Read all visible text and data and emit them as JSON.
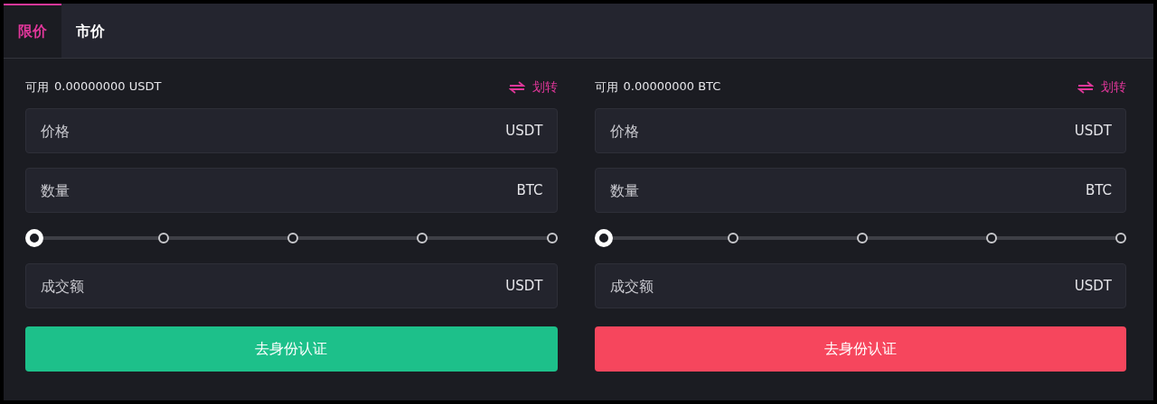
{
  "tabs": [
    {
      "label": "限价",
      "selected": true
    },
    {
      "label": "市价",
      "selected": false
    }
  ],
  "panels": [
    {
      "available_label": "可用",
      "available_value": "0.00000000 USDT",
      "transfer": "划转",
      "fields": [
        {
          "placeholder": "价格",
          "unit": "USDT"
        },
        {
          "placeholder": "数量",
          "unit": "BTC"
        }
      ],
      "slider": {
        "level": 0
      },
      "total": {
        "placeholder": "成交额",
        "unit": "USDT"
      },
      "button": {
        "label": "去身份认证",
        "kind": "buy"
      }
    },
    {
      "available_label": "可用",
      "available_value": "0.00000000 BTC",
      "transfer": "划转",
      "fields": [
        {
          "placeholder": "价格",
          "unit": "USDT"
        },
        {
          "placeholder": "数量",
          "unit": "BTC"
        }
      ],
      "slider": {
        "level": 0
      },
      "total": {
        "placeholder": "成交额",
        "unit": "USDT"
      },
      "button": {
        "label": "去身份认证",
        "kind": "sell"
      }
    }
  ]
}
